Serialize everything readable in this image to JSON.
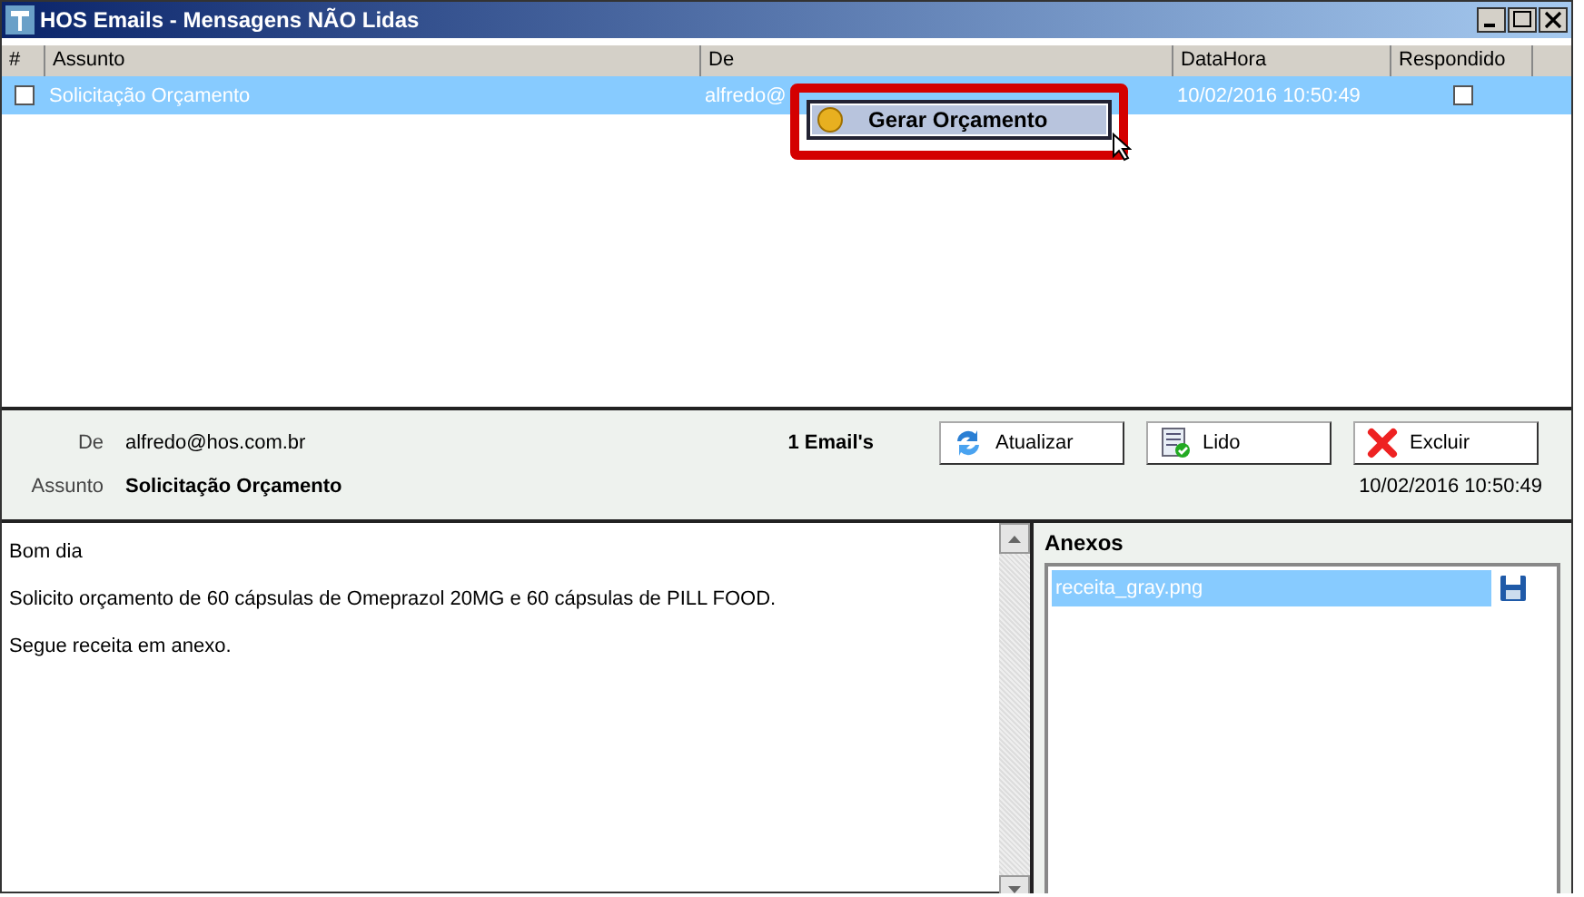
{
  "window": {
    "title": "HOS Emails - Mensagens NÃO Lidas"
  },
  "table": {
    "columns": [
      "#",
      "Assunto",
      "De",
      "DataHora",
      "Respondido"
    ],
    "rows": [
      {
        "checked": false,
        "selected": true,
        "assunto": "Solicitação Orçamento",
        "de": "alfredo@",
        "datahora": "10/02/2016 10:50:49",
        "respondido": false
      }
    ]
  },
  "context_menu": {
    "items": [
      {
        "label": "Gerar Orçamento"
      }
    ]
  },
  "details": {
    "de_label": "De",
    "de": "alfredo@hos.com.br",
    "assunto_label": "Assunto",
    "assunto": "Solicitação Orçamento",
    "count": "1 Email's",
    "datahora": "10/02/2016 10:50:49",
    "buttons": [
      {
        "label": "Atualizar",
        "kind": "refresh"
      },
      {
        "label": "Lido",
        "kind": "read"
      },
      {
        "label": "Excluir",
        "kind": "delete"
      }
    ]
  },
  "body": {
    "paragraphs": [
      "Bom dia",
      "Solicito orçamento de 60 cápsulas de Omeprazol 20MG e 60 cápsulas de PILL FOOD.",
      "Segue receita em anexo."
    ]
  },
  "attachments": {
    "title": "Anexos",
    "items": [
      {
        "name": "receita_gray.png",
        "selected": true
      }
    ]
  }
}
